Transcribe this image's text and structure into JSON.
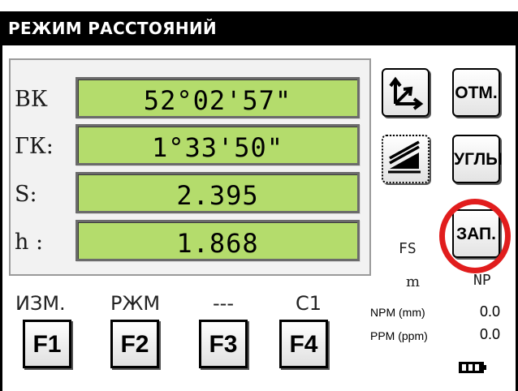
{
  "title": "РЕЖИМ РАССТОЯНИЙ",
  "measurements": [
    {
      "label": "ВК",
      "value": "52°02'57\""
    },
    {
      "label": "ГК:",
      "value": "1°33'50\""
    },
    {
      "label": "S:",
      "value": "2.395"
    },
    {
      "label": "h :",
      "value": "1.868"
    }
  ],
  "side_buttons": {
    "coord_icon": "coordinate-axes-icon",
    "otm": "ОТМ.",
    "layers_icon": "layers-icon",
    "angles": "УГЛЫ",
    "record": "ЗАП."
  },
  "status": {
    "fs": "FS",
    "unit": "m",
    "np": "NP",
    "npm_label": "NPM (mm)",
    "npm_value": "0.0",
    "ppm_label": "PPM (ppm)",
    "ppm_value": "0.0",
    "battery_icon": "battery-icon"
  },
  "function_keys": [
    {
      "label": "ИЗМ.",
      "key": "F1"
    },
    {
      "label": "РЖМ",
      "key": "F2"
    },
    {
      "label": "---",
      "key": "F3"
    },
    {
      "label": "C1",
      "key": "F4"
    }
  ],
  "colors": {
    "lcd": "#b4dc6c",
    "title_bar": "#000000",
    "highlight_ring": "#e11d1d"
  }
}
